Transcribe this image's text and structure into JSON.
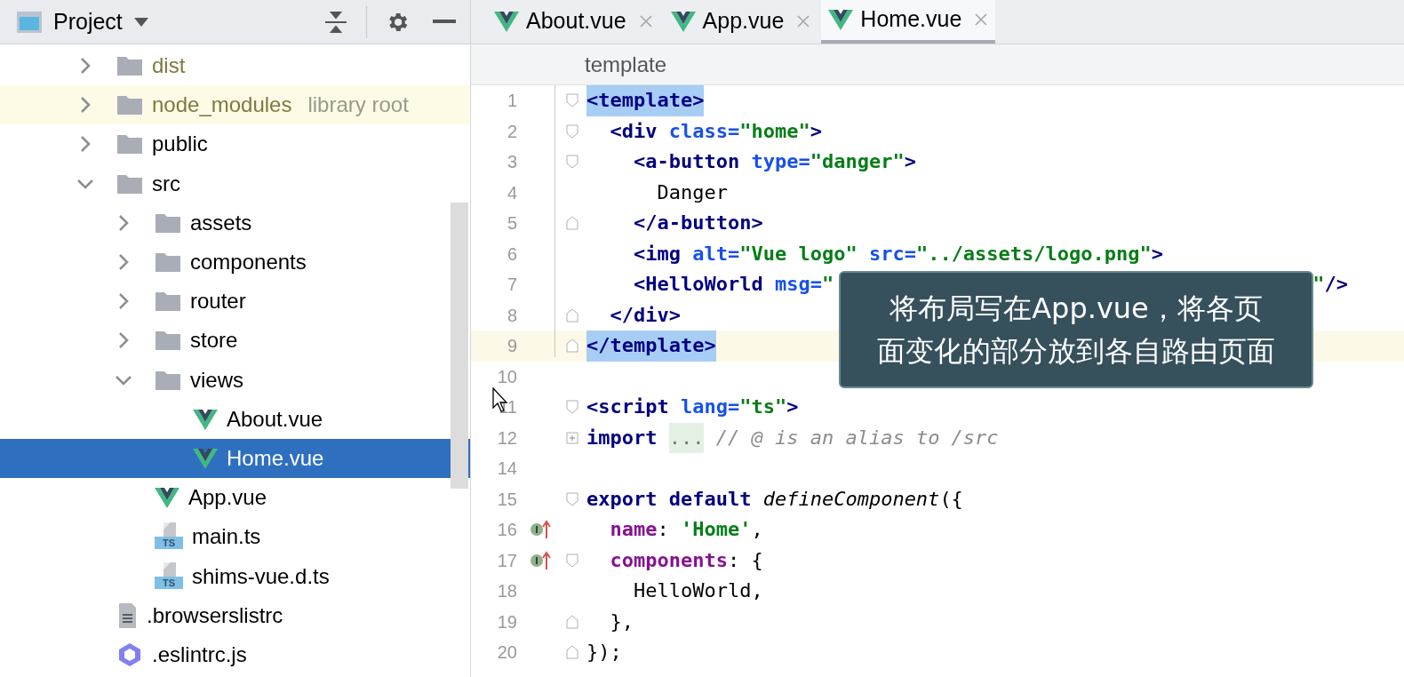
{
  "project_panel": {
    "title": "Project",
    "tree": [
      {
        "name": "dist",
        "kind": "folder",
        "expanded": false,
        "excluded": true,
        "selected": false
      },
      {
        "name": "node_modules",
        "hint": "library root",
        "kind": "folder",
        "expanded": false,
        "excluded": true,
        "selected": false
      },
      {
        "name": "public",
        "kind": "folder",
        "expanded": false,
        "excluded": false,
        "selected": false
      },
      {
        "name": "src",
        "kind": "folder",
        "expanded": true,
        "excluded": false,
        "selected": false,
        "children": [
          {
            "name": "assets",
            "kind": "folder",
            "expanded": false,
            "excluded": false,
            "selected": false
          },
          {
            "name": "components",
            "kind": "folder",
            "expanded": false,
            "excluded": false,
            "selected": false
          },
          {
            "name": "router",
            "kind": "folder",
            "expanded": false,
            "excluded": false,
            "selected": false
          },
          {
            "name": "store",
            "kind": "folder",
            "expanded": false,
            "excluded": false,
            "selected": false
          },
          {
            "name": "views",
            "kind": "folder",
            "expanded": true,
            "excluded": false,
            "selected": false,
            "children": [
              {
                "name": "About.vue",
                "kind": "vue",
                "excluded": false,
                "selected": false
              },
              {
                "name": "Home.vue",
                "kind": "vue",
                "excluded": false,
                "selected": true
              }
            ]
          },
          {
            "name": "App.vue",
            "kind": "vue",
            "excluded": false,
            "selected": false
          },
          {
            "name": "main.ts",
            "kind": "ts",
            "badge": "TS",
            "excluded": false,
            "selected": false
          },
          {
            "name": "shims-vue.d.ts",
            "kind": "ts",
            "badge": "TS",
            "excluded": false,
            "selected": false
          }
        ]
      },
      {
        "name": ".browserslistrc",
        "kind": "text",
        "excluded": false,
        "selected": false
      },
      {
        "name": ".eslintrc.js",
        "kind": "eslint",
        "excluded": false,
        "selected": false
      }
    ]
  },
  "tabs": [
    {
      "label": "About.vue",
      "selected": false
    },
    {
      "label": "App.vue",
      "selected": false
    },
    {
      "label": "Home.vue",
      "selected": true
    }
  ],
  "breadcrumb": "template",
  "code_lines": [
    {
      "num": "1",
      "fold_marker": {
        "kind": "start"
      },
      "current": false,
      "tokens": [
        {
          "text": "<template>",
          "kind": "matched_tag"
        }
      ]
    },
    {
      "num": "2",
      "fold_marker": {
        "kind": "start"
      },
      "current": false,
      "tokens": [
        {
          "text": "  <div",
          "kind": "tag"
        },
        {
          "text": " class=",
          "kind": "attr"
        },
        {
          "text": "\"home\"",
          "kind": "str"
        },
        {
          "text": ">",
          "kind": "tag"
        }
      ]
    },
    {
      "num": "3",
      "fold_marker": {
        "kind": "start"
      },
      "current": false,
      "tokens": [
        {
          "text": "    <a-button",
          "kind": "tag"
        },
        {
          "text": " type=",
          "kind": "attr"
        },
        {
          "text": "\"danger\"",
          "kind": "str"
        },
        {
          "text": ">",
          "kind": "tag"
        }
      ]
    },
    {
      "num": "4",
      "current": false,
      "tokens": [
        {
          "text": "      Danger",
          "kind": "plain"
        }
      ]
    },
    {
      "num": "5",
      "fold_marker": {
        "kind": "end"
      },
      "current": false,
      "tokens": [
        {
          "text": "    </a-button>",
          "kind": "tag"
        }
      ]
    },
    {
      "num": "6",
      "current": false,
      "tokens": [
        {
          "text": "    <img",
          "kind": "tag"
        },
        {
          "text": " alt=",
          "kind": "attr"
        },
        {
          "text": "\"Vue logo\"",
          "kind": "str"
        },
        {
          "text": " src=",
          "kind": "attr"
        },
        {
          "text": "\"../assets/logo.png\"",
          "kind": "str"
        },
        {
          "text": ">",
          "kind": "tag"
        }
      ]
    },
    {
      "num": "7",
      "current": false,
      "tokens": [
        {
          "text": "    <HelloWorld",
          "kind": "tag"
        },
        {
          "text": " msg=",
          "kind": "attr"
        },
        {
          "text": "\"",
          "kind": "str"
        }
      ],
      "tail": [
        {
          "text": "\"",
          "kind": "str"
        },
        {
          "text": "/>",
          "kind": "tag"
        }
      ]
    },
    {
      "num": "8",
      "fold_marker": {
        "kind": "end"
      },
      "current": false,
      "tokens": [
        {
          "text": "  </div>",
          "kind": "tag"
        }
      ]
    },
    {
      "num": "9",
      "fold_marker": {
        "kind": "end"
      },
      "current": true,
      "tokens": [
        {
          "text": "</template>",
          "kind": "matched_tag"
        }
      ]
    },
    {
      "num": "10",
      "current": false
    },
    {
      "num": "11",
      "fold_marker": {
        "kind": "start"
      },
      "current": false,
      "tokens": [
        {
          "text": "<script",
          "kind": "tag"
        },
        {
          "text": " lang=",
          "kind": "attr"
        },
        {
          "text": "\"ts\"",
          "kind": "str"
        },
        {
          "text": ">",
          "kind": "tag"
        }
      ]
    },
    {
      "num": "12",
      "fold_marker": {
        "kind": "collapsed"
      },
      "current": false,
      "tokens": [
        {
          "text": "import ",
          "kind": "keyword"
        },
        {
          "text": "...",
          "kind": "folded"
        },
        {
          "text": " // @ is an alias to /src",
          "kind": "comment"
        }
      ]
    },
    {
      "num": "14",
      "current": false
    },
    {
      "num": "15",
      "fold_marker": {
        "kind": "start"
      },
      "current": false,
      "tokens": [
        {
          "text": "export default ",
          "kind": "keyword"
        },
        {
          "text": "defineComponent",
          "kind": "function"
        },
        {
          "text": "({",
          "kind": "plain"
        }
      ]
    },
    {
      "num": "16",
      "gutter_icon": {
        "kind": "implements"
      },
      "current": false,
      "tokens": [
        {
          "text": "  name",
          "kind": "property"
        },
        {
          "text": ": ",
          "kind": "plain"
        },
        {
          "text": "'Home'",
          "kind": "str"
        },
        {
          "text": ",",
          "kind": "plain"
        }
      ]
    },
    {
      "num": "17",
      "gutter_icon": {
        "kind": "implements"
      },
      "fold_marker": {
        "kind": "start"
      },
      "current": false,
      "tokens": [
        {
          "text": "  components",
          "kind": "property"
        },
        {
          "text": ": {",
          "kind": "plain"
        }
      ]
    },
    {
      "num": "18",
      "current": false,
      "tokens": [
        {
          "text": "    HelloWorld,",
          "kind": "plain"
        }
      ]
    },
    {
      "num": "19",
      "fold_marker": {
        "kind": "end"
      },
      "current": false,
      "tokens": [
        {
          "text": "  },",
          "kind": "plain"
        }
      ]
    },
    {
      "num": "20",
      "fold_marker": {
        "kind": "end"
      },
      "current": false,
      "tokens": [
        {
          "text": "});",
          "kind": "plain"
        }
      ]
    }
  ],
  "caption": {
    "lines": [
      "将布局写在App.vue，将各页",
      "面变化的部分放到各自路由页面"
    ]
  }
}
